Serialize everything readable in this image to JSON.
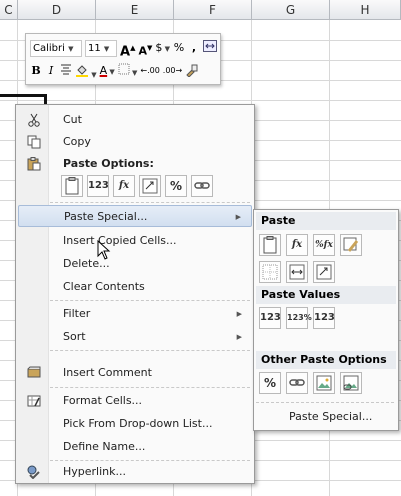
{
  "columns": [
    "C",
    "D",
    "E",
    "F",
    "G",
    "H"
  ],
  "mini_toolbar": {
    "font_name": "Calibri",
    "font_size": "11",
    "grow_font": "A",
    "shrink_font": "A",
    "currency": "$",
    "percent": "%",
    "comma": ",",
    "bold": "B",
    "italic": "I",
    "font_color_letter": "A",
    "decimal_increase": ".00",
    "decimal_decrease": ".00"
  },
  "context_menu": {
    "cut": "Cut",
    "copy": "Copy",
    "paste_options": "Paste Options:",
    "paste_buttons": [
      "",
      "123",
      "fx",
      "",
      "%",
      ""
    ],
    "paste_special": "Paste Special...",
    "insert_copied": "Insert Copied Cells...",
    "delete": "Delete...",
    "clear_contents": "Clear Contents",
    "filter": "Filter",
    "sort": "Sort",
    "insert_comment": "Insert Comment",
    "format_cells": "Format Cells...",
    "pick_list": "Pick From Drop-down List...",
    "define_name": "Define Name...",
    "hyperlink": "Hyperlink..."
  },
  "submenu": {
    "paste_header": "Paste",
    "paste_values_header": "Paste Values",
    "other_header": "Other Paste Options",
    "paste_special": "Paste Special...",
    "btn_fx": "fx",
    "btn_fx_pct": "%fx",
    "btn_123": "123",
    "btn_123_pct": "123%",
    "btn_123_b": "123",
    "btn_pct": "%"
  }
}
